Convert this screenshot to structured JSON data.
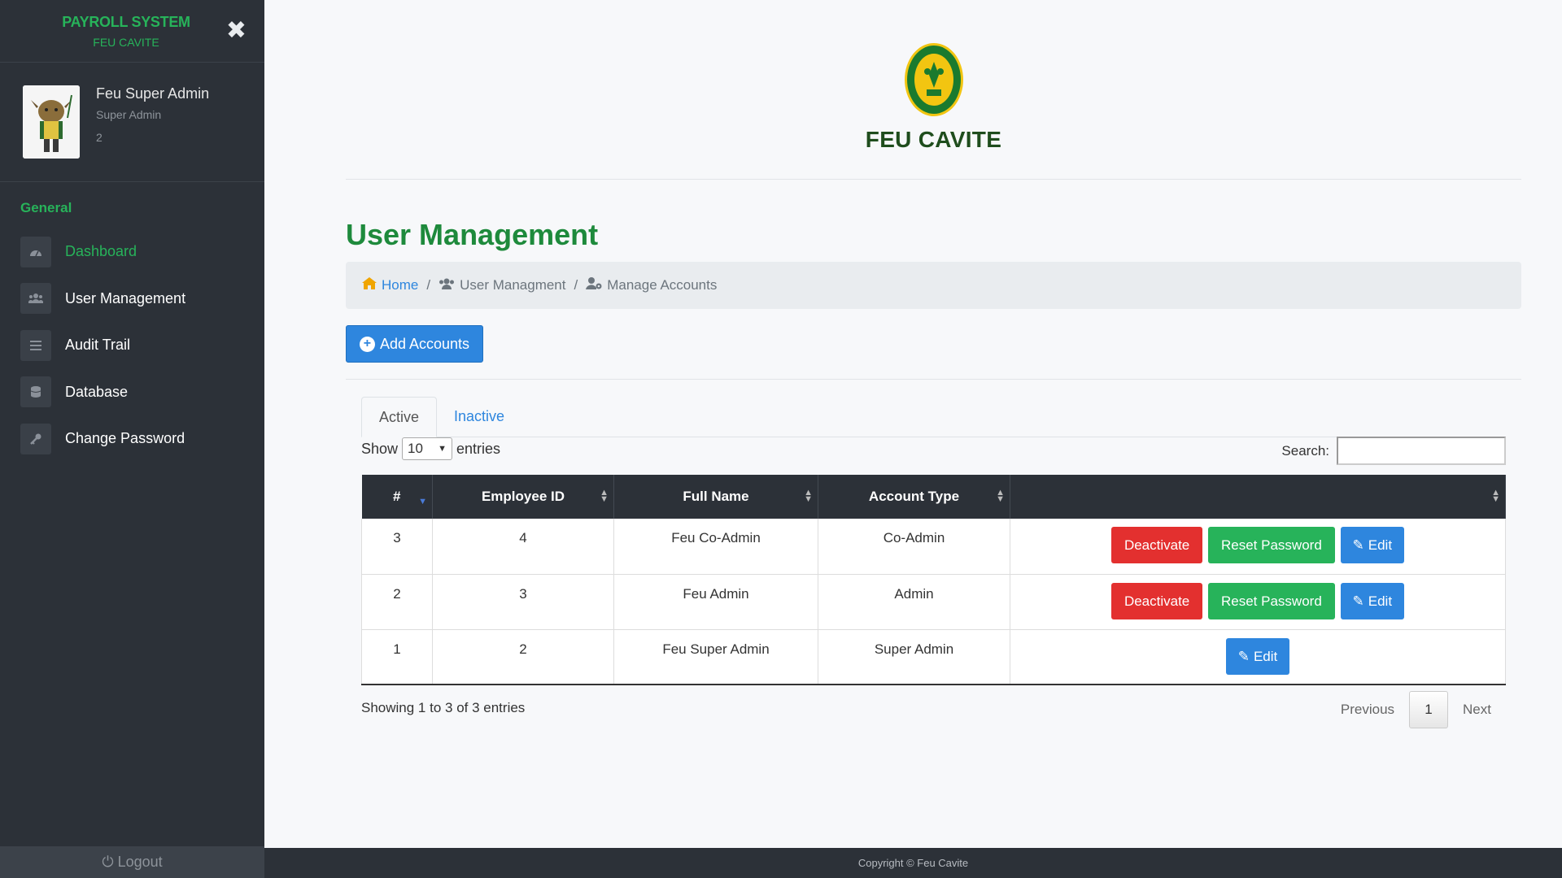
{
  "app": {
    "system_title": "PAYROLL SYSTEM",
    "system_subtitle": "FEU CAVITE",
    "close_symbol": "✖"
  },
  "profile": {
    "name": "Feu Super Admin",
    "role": "Super Admin",
    "id": "2"
  },
  "sidebar": {
    "section_title": "General",
    "items": [
      {
        "label": "Dashboard",
        "icon": "dashboard-icon",
        "active": true
      },
      {
        "label": "User Management",
        "icon": "users-icon",
        "active": false
      },
      {
        "label": "Audit Trail",
        "icon": "list-icon",
        "active": false
      },
      {
        "label": "Database",
        "icon": "database-icon",
        "active": false
      },
      {
        "label": "Change Password",
        "icon": "key-icon",
        "active": false
      }
    ],
    "logout_label": "Logout"
  },
  "header": {
    "title": "FEU CAVITE"
  },
  "page": {
    "title": "User Management"
  },
  "breadcrumb": {
    "home": "Home",
    "section": "User Managment",
    "current": "Manage Accounts"
  },
  "toolbar": {
    "add_label": "Add Accounts"
  },
  "tabs": {
    "active": "Active",
    "inactive": "Inactive"
  },
  "table_controls": {
    "show_label": "Show",
    "entries_value": "10",
    "entries_label": "entries",
    "search_label": "Search:",
    "search_value": ""
  },
  "table": {
    "headers": [
      "#",
      "Employee ID",
      "Full Name",
      "Account Type",
      ""
    ],
    "rows": [
      {
        "num": "3",
        "employee_id": "4",
        "full_name": "Feu Co-Admin",
        "account_type": "Co-Admin",
        "deactivate": "Deactivate",
        "reset": "Reset Password",
        "edit": "Edit"
      },
      {
        "num": "2",
        "employee_id": "3",
        "full_name": "Feu Admin",
        "account_type": "Admin",
        "deactivate": "Deactivate",
        "reset": "Reset Password",
        "edit": "Edit"
      },
      {
        "num": "1",
        "employee_id": "2",
        "full_name": "Feu Super Admin",
        "account_type": "Super Admin",
        "edit": "Edit"
      }
    ]
  },
  "pagination": {
    "info": "Showing 1 to 3 of 3 entries",
    "previous": "Previous",
    "page": "1",
    "next": "Next"
  },
  "footer": {
    "copyright": "Copyright © Feu Cavite"
  },
  "colors": {
    "sidebar_bg": "#2c3138",
    "accent_green": "#27b35a",
    "primary_blue": "#2e86de",
    "danger_red": "#e3302f"
  }
}
